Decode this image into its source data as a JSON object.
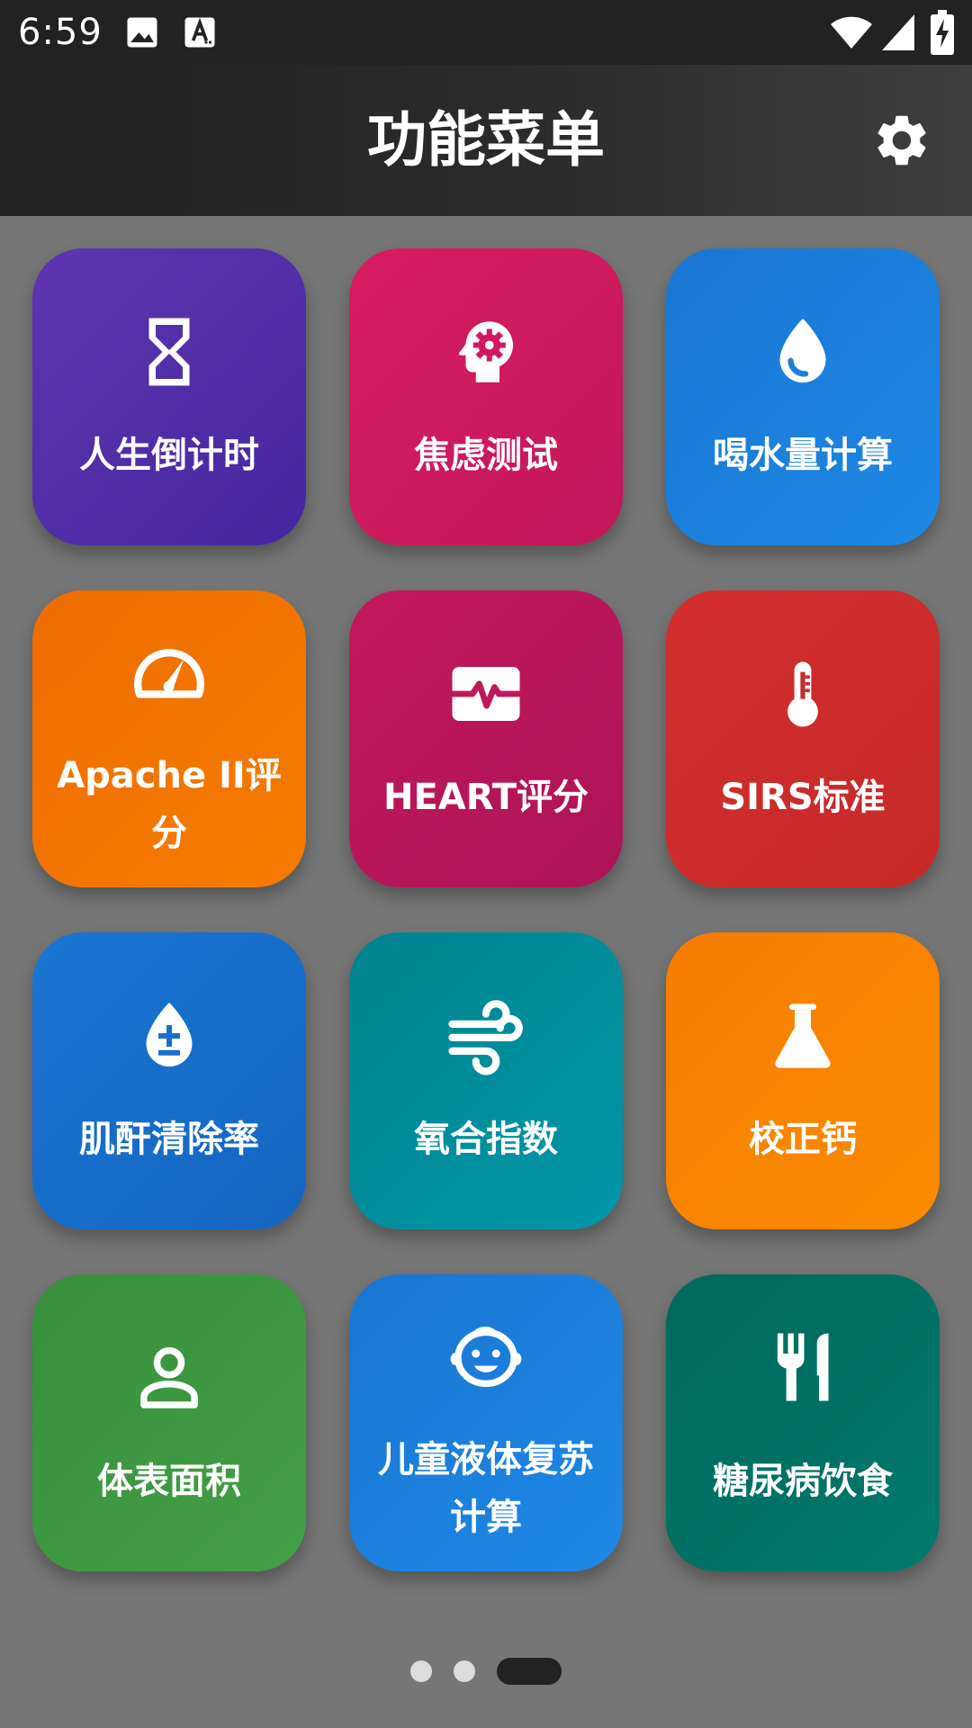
{
  "status_bar": {
    "time": "6:59",
    "icons": [
      "image-icon",
      "text-a-icon",
      "wifi-icon",
      "signal-icon",
      "battery-charging-icon"
    ]
  },
  "app_bar": {
    "title": "功能菜单",
    "settings_icon": "gear-icon"
  },
  "tiles": [
    {
      "label": "人生倒计时",
      "icon": "hourglass-icon",
      "color_start": "#5e35b1",
      "color_end": "#4527a0"
    },
    {
      "label": "焦虑测试",
      "icon": "head-gear-icon",
      "color_start": "#d81b60",
      "color_end": "#c2185b"
    },
    {
      "label": "喝水量计算",
      "icon": "water-drop-icon",
      "color_start": "#1976d2",
      "color_end": "#1e88e5"
    },
    {
      "label": "Apache II评分",
      "icon": "speedometer-icon",
      "color_start": "#ef6c00",
      "color_end": "#f57c00"
    },
    {
      "label": "HEART评分",
      "icon": "heart-monitor-icon",
      "color_start": "#c2185b",
      "color_end": "#ad1457"
    },
    {
      "label": "SIRS标准",
      "icon": "thermometer-icon",
      "color_start": "#d32f2f",
      "color_end": "#c62828"
    },
    {
      "label": "肌酐清除率",
      "icon": "drop-plus-minus-icon",
      "color_start": "#1976d2",
      "color_end": "#1565c0"
    },
    {
      "label": "氧合指数",
      "icon": "wind-icon",
      "color_start": "#00838f",
      "color_end": "#0097a7"
    },
    {
      "label": "校正钙",
      "icon": "flask-icon",
      "color_start": "#f57c00",
      "color_end": "#fb8c00"
    },
    {
      "label": "体表面积",
      "icon": "person-icon",
      "color_start": "#388e3c",
      "color_end": "#43a047"
    },
    {
      "label": "儿童液体复苏计算",
      "icon": "baby-face-icon",
      "color_start": "#1976d2",
      "color_end": "#1e88e5"
    },
    {
      "label": "糖尿病饮食",
      "icon": "fork-knife-icon",
      "color_start": "#00695c",
      "color_end": "#00796b"
    }
  ],
  "pager": {
    "pages": 3,
    "active_index": 2
  },
  "colors": {
    "background": "#767676",
    "status_bar": "#222222",
    "dot_inactive": "#dcdcdc",
    "dot_active": "#222222"
  }
}
